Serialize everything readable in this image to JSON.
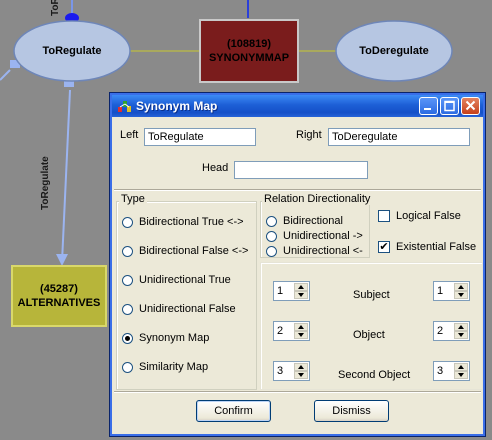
{
  "graph": {
    "nodes": {
      "toregulate": "ToRegulate",
      "synonymmap_id": "(108819)",
      "synonymmap_name": "SYNONYMMAP",
      "toderegulate": "ToDeregulate",
      "alternatives_id": "(45287)",
      "alternatives_name": "ALTERNATIVES"
    },
    "edges": {
      "top_label": "ToRe",
      "vertical_label": "ToRegulate"
    },
    "colors": {
      "background": "#8a8a8a",
      "oval_node": "#b6c6e2",
      "synonymmap_node": "#7a1c1c",
      "alternatives_node": "#b7b53a",
      "edge": "#9bb4f0"
    }
  },
  "dialog": {
    "title": "Synonym Map",
    "title_icon": "app-map-icon",
    "fields": {
      "left_label": "Left",
      "left_value": "ToRegulate",
      "right_label": "Right",
      "right_value": "ToDeregulate",
      "head_label": "Head",
      "head_value": ""
    },
    "type_group": {
      "label": "Type",
      "options": [
        "Bidirectional True  <->",
        "Bidirectional False <->",
        "Unidirectional True",
        "Unidirectional False",
        "Synonym Map",
        "Similarity Map"
      ],
      "selected": "Synonym Map"
    },
    "direction_group": {
      "label": "Relation Directionality",
      "options": [
        "Bidirectional",
        "Unidirectional ->",
        "Unidirectional <-"
      ]
    },
    "checks": {
      "logical_false_label": "Logical False",
      "logical_false_checked": false,
      "existential_false_label": "Existential False",
      "existential_false_checked": true
    },
    "spinners": {
      "subject_label": "Subject",
      "object_label": "Object",
      "second_object_label": "Second Object",
      "left": [
        "1",
        "2",
        "3"
      ],
      "right": [
        "1",
        "2",
        "3"
      ]
    },
    "buttons": {
      "confirm": "Confirm",
      "dismiss": "Dismiss"
    }
  }
}
